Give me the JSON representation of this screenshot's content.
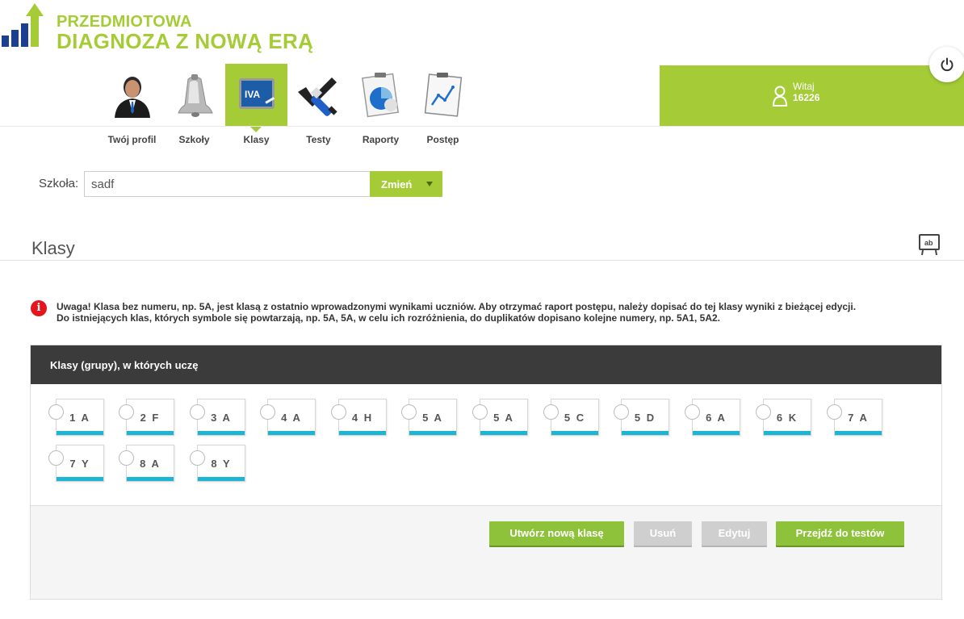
{
  "logo": {
    "line1": "PRZEDMIOTOWA",
    "line2": "DIAGNOZA Z NOWĄ ERĄ"
  },
  "nav": {
    "items": [
      {
        "label": "Twój profil",
        "icon": "profile-person-icon"
      },
      {
        "label": "Szkoły",
        "icon": "bell-icon"
      },
      {
        "label": "Klasy",
        "icon": "class-board-icon",
        "badge": "IVA",
        "active": true
      },
      {
        "label": "Testy",
        "icon": "check-pen-icon"
      },
      {
        "label": "Raporty",
        "icon": "report-chart-icon"
      },
      {
        "label": "Postęp",
        "icon": "progress-chart-icon"
      }
    ]
  },
  "welcome": {
    "greeting": "Witaj",
    "user_id": "16226"
  },
  "school": {
    "label": "Szkoła:",
    "value": "sadf",
    "button": "Zmień"
  },
  "page": {
    "title": "Klasy"
  },
  "warning": {
    "line1": "Uwaga! Klasa bez numeru, np. 5A, jest klasą z ostatnio wprowadzonymi wynikami uczniów. Aby otrzymać raport postępu, należy dopisać do tej klasy wyniki z bieżącej edycji.",
    "line2": "Do istniejących klas, których symbole się powtarzają, np. 5A, 5A, w celu ich rozróżnienia, do duplikatów dopisano kolejne numery, np. 5A1, 5A2."
  },
  "panel": {
    "title": "Klasy (grupy), w których uczę",
    "classes": [
      "1 A",
      "2 F",
      "3 A",
      "4 A",
      "4 H",
      "5 A",
      "5 A",
      "5 C",
      "5 D",
      "6 A",
      "6 K",
      "7 A",
      "7 Y",
      "8 A",
      "8 Y"
    ],
    "buttons": {
      "create": "Utwórz nową klasę",
      "delete": "Usuń",
      "edit": "Edytuj",
      "go_tests": "Przejdź do testów"
    }
  },
  "colors": {
    "brand_green": "#a5cc36",
    "accent_blue": "#1cb5d3",
    "dark_header": "#3b3b3b",
    "alert_red": "#e4151f"
  }
}
